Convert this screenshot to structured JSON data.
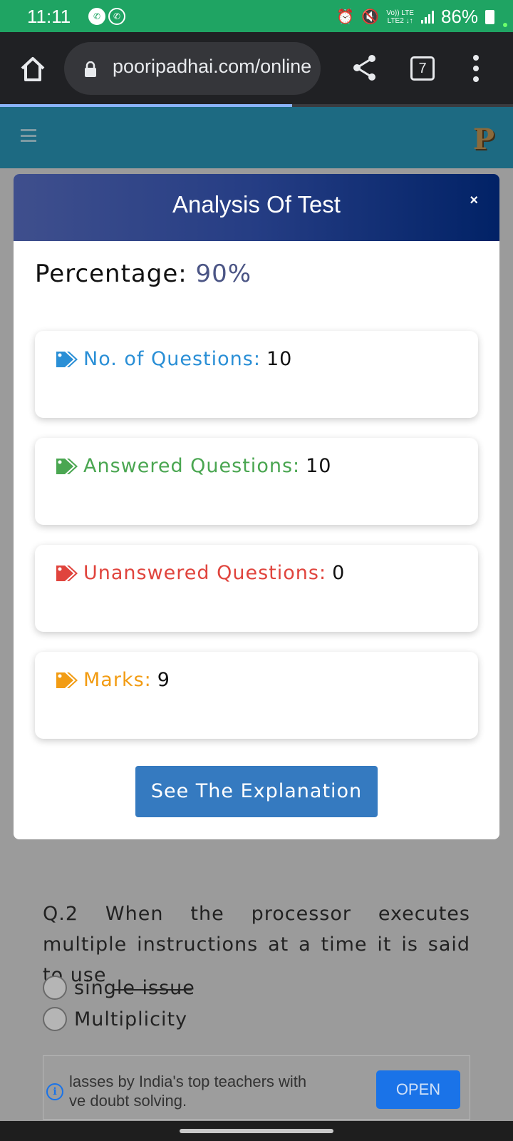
{
  "status_bar": {
    "time": "11:11",
    "lte_top": "Vo)) LTE",
    "lte_bottom": "LTE2 ↓↑",
    "battery": "86%",
    "icons": [
      "phone-icon",
      "whatsapp-icon",
      "alarm-icon",
      "mute-icon",
      "signal-icon",
      "battery-icon"
    ]
  },
  "browser": {
    "url": "pooripadhai.com/online",
    "tab_count": "7",
    "page_load_progress": 0.57,
    "colors": {
      "bar": "#202124",
      "progress": "#8ab4f8"
    }
  },
  "site_header": {
    "logo": "P",
    "color": "#1d6a82"
  },
  "modal": {
    "title": "Analysis Of Test",
    "close_label": "×",
    "percentage_label": "Percentage:",
    "percentage_value": "90%",
    "stats": [
      {
        "label": "No. of Questions:",
        "value": "10",
        "color": "#2a8fd6",
        "icon": "tag-icon"
      },
      {
        "label": "Answered Questions:",
        "value": "10",
        "color": "#4aa651",
        "icon": "tag-icon"
      },
      {
        "label": "Unanswered Questions:",
        "value": "0",
        "color": "#e0443d",
        "icon": "tag-icon"
      },
      {
        "label": "Marks:",
        "value": "9",
        "color": "#f29c13",
        "icon": "tag-icon"
      }
    ],
    "button_label": "See The Explanation"
  },
  "question": {
    "text": "Q.2 When the processor executes multiple instructions at a time it is said to use",
    "options": [
      "single issue",
      "Multiplicity"
    ]
  },
  "ad": {
    "line1": "lasses by India's top teachers with",
    "line2": "ve doubt solving.",
    "info": "i",
    "button": "OPEN"
  }
}
